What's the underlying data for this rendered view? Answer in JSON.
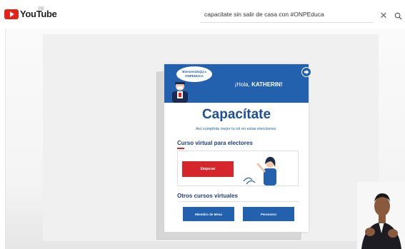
{
  "youtube": {
    "logo_text": "YouTube",
    "region": "PE",
    "search_value": "capacitate sin salir de casa con #ONPEduca",
    "clear_glyph": "✕"
  },
  "colors": {
    "brand_blue": "#2360ad",
    "brand_red": "#d7262b",
    "youtube_red": "#e62117"
  },
  "video": {
    "card": {
      "bubble_text": "Bienvenido(a) a ONPEDUCA",
      "greeting_prefix": "¡Hola, ",
      "greeting_name": "KATHERIN!",
      "title": "Capacítate",
      "subtitle": "Así cumplirás mejor tu rol en estas elecciones.",
      "section1_title": "Curso virtual para electores",
      "start_label": "Empezar",
      "section2_title": "Otros cursos virtuales",
      "buttons": [
        "Miembro de Mesa",
        "Personero"
      ]
    }
  }
}
